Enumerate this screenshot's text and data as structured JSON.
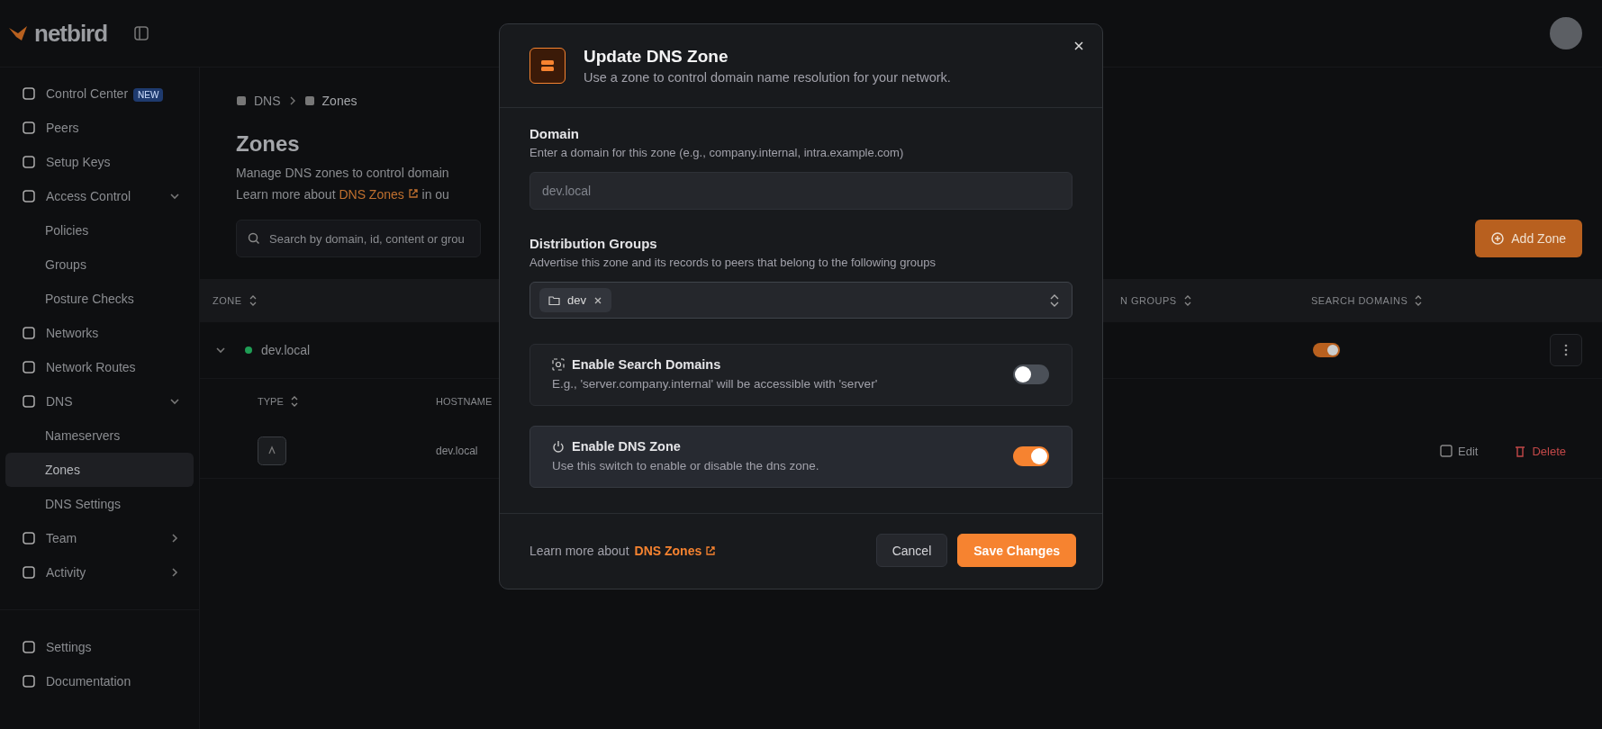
{
  "header": {
    "logo": "netbird"
  },
  "sidebar": {
    "items": [
      {
        "label": "Control Center",
        "badge": "NEW",
        "selected": false
      },
      {
        "label": "Peers",
        "selected": false
      },
      {
        "label": "Setup Keys",
        "selected": false
      },
      {
        "label": "Access Control",
        "selected": false,
        "expanded": true,
        "children": [
          {
            "label": "Policies",
            "selected": false
          },
          {
            "label": "Groups",
            "selected": false
          },
          {
            "label": "Posture Checks",
            "selected": false
          }
        ]
      },
      {
        "label": "Networks",
        "selected": false
      },
      {
        "label": "Network Routes",
        "selected": false
      },
      {
        "label": "DNS",
        "selected": false,
        "expanded": true,
        "children": [
          {
            "label": "Nameservers",
            "selected": false
          },
          {
            "label": "Zones",
            "selected": true
          },
          {
            "label": "DNS Settings",
            "selected": false
          }
        ]
      },
      {
        "label": "Team",
        "selected": false,
        "expanded": false
      },
      {
        "label": "Activity",
        "selected": false,
        "expanded": false
      }
    ],
    "footer_items": [
      {
        "label": "Settings",
        "selected": false
      },
      {
        "label": "Documentation",
        "selected": false
      }
    ]
  },
  "page": {
    "breadcrumbs": [
      "DNS",
      "Zones"
    ],
    "title": "Zones",
    "description": "Manage DNS zones to control domain",
    "learn_more": "Learn more about",
    "learn_link": "DNS Zones",
    "learn_after": "in ou",
    "search": {
      "placeholder": "Search by domain, id, content or grou"
    },
    "add_button": "Add Zone",
    "table": {
      "columns": [
        "ZONE",
        "N GROUPS",
        "SEARCH DOMAINS"
      ],
      "rows": [
        {
          "zone": "dev.local",
          "color": "#1f9d55",
          "search_domains": true,
          "expanded": true
        }
      ],
      "sub_columns": [
        "TYPE",
        "HOSTNAME"
      ],
      "sub_rows": [
        {
          "hostname": "dev.local",
          "actions": [
            "Edit",
            "Delete"
          ]
        }
      ]
    }
  },
  "modal": {
    "title": "Update DNS Zone",
    "subtitle": "Use a zone to control domain name resolution for your network.",
    "fields": [
      {
        "kind": "text",
        "label": "Domain",
        "hint": "Enter a domain for this zone (e.g., company.internal, intra.example.com)",
        "value": "dev.local",
        "disabled": true
      },
      {
        "kind": "tags",
        "label": "Distribution Groups",
        "hint": "Advertise this zone and its records to peers that belong to the following groups",
        "tags": [
          "dev"
        ]
      }
    ],
    "switches": [
      {
        "title": "Enable Search Domains",
        "description": "E.g., 'server.company.internal' will be accessible with 'server'",
        "on": false,
        "highlighted": false
      },
      {
        "title": "Enable DNS Zone",
        "description": "Use this switch to enable or disable the dns zone.",
        "on": true,
        "highlighted": true
      }
    ],
    "footer": {
      "text": "Learn more about",
      "link": "DNS Zones"
    },
    "buttons": [
      {
        "label": "Cancel",
        "kind": "secondary"
      },
      {
        "label": "Save Changes",
        "kind": "primary"
      }
    ]
  }
}
